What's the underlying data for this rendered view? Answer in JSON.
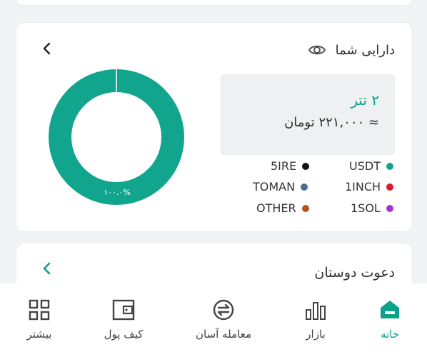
{
  "assets_card": {
    "title": "دارایی شما",
    "balance_main": "۲ تتر",
    "balance_sub": "≈ ۲۲۱,۰۰۰ تومان",
    "legend": [
      {
        "label": "USDT",
        "color": "#12a58e"
      },
      {
        "label": "5IRE",
        "color": "#111111"
      },
      {
        "label": "1INCH",
        "color": "#d91c2a"
      },
      {
        "label": "TOMAN",
        "color": "#4f6896"
      },
      {
        "label": "1SOL",
        "color": "#a632d6"
      },
      {
        "label": "OTHER",
        "color": "#b5521b"
      }
    ]
  },
  "chart_data": {
    "type": "pie",
    "slices": [
      {
        "label": "USDT",
        "value": 100.0,
        "color": "#12a58e"
      }
    ],
    "data_labels": [
      "۱۰۰.۰%"
    ]
  },
  "invite_card": {
    "title": "دعوت دوستان"
  },
  "bottom_nav": {
    "items": [
      {
        "label": "خانه",
        "icon": "home-icon",
        "active": true
      },
      {
        "label": "بازار",
        "icon": "bar-chart-icon",
        "active": false
      },
      {
        "label": "معامله آسان",
        "icon": "exchange-icon",
        "active": false
      },
      {
        "label": "کیف پول",
        "icon": "wallet-icon",
        "active": false
      },
      {
        "label": "بیشتر",
        "icon": "grid-icon",
        "active": false
      }
    ]
  },
  "colors": {
    "accent": "#0ba289",
    "donut": "#12a58e"
  }
}
